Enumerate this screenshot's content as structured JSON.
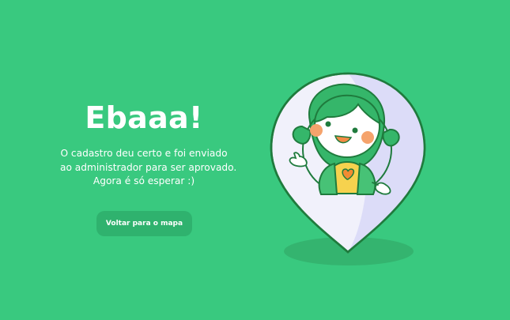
{
  "success": {
    "title": "Ebaaa!",
    "message_lines": [
      "O cadastro deu certo e foi enviado",
      "ao administrador para ser aprovado.",
      "Agora é só esperar :)"
    ],
    "back_button_label": "Voltar para o mapa"
  },
  "illustration": {
    "icon": "map-pin-with-girl-illustration"
  },
  "colors": {
    "background": "#39c97f",
    "button": "#2fb26e",
    "pin_fill": "#f1f1fb",
    "pin_outline": "#1f7b3d",
    "shadow": "#34b46f",
    "text": "#ffffff"
  }
}
